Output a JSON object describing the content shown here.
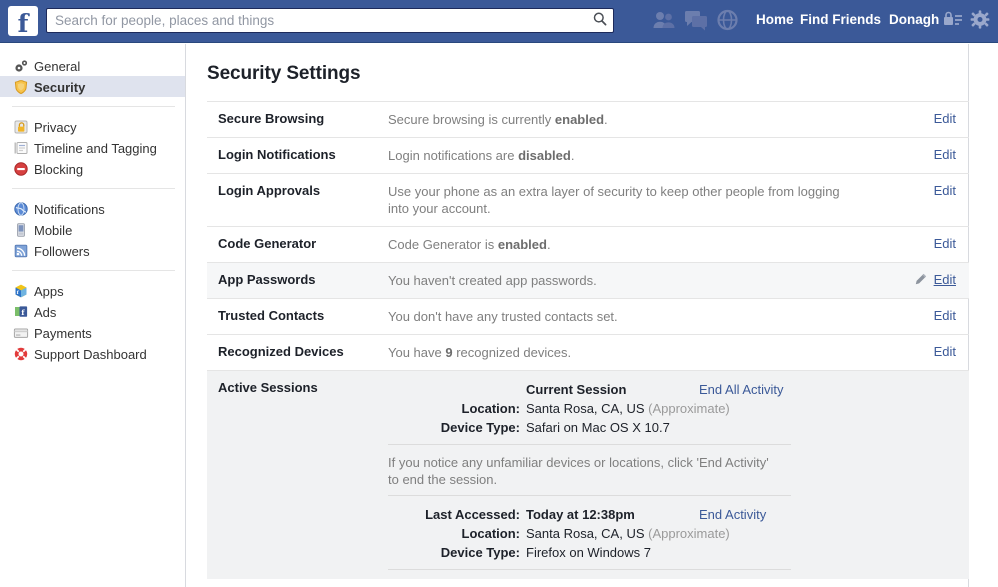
{
  "topbar": {
    "logo_letter": "f",
    "search": {
      "placeholder": "Search for people, places and things",
      "value": ""
    },
    "icons": {
      "friends": "friend-requests-icon",
      "messages": "messages-icon",
      "globe": "notifications-globe-icon",
      "privacy_shortcut": "privacy-shortcuts-icon",
      "settings": "gear-icon"
    },
    "links": {
      "home": "Home",
      "find_friends": "Find Friends",
      "profile": "Donagh"
    }
  },
  "sidebar": {
    "groups": [
      {
        "items": [
          {
            "label": "General",
            "icon": "gears-icon",
            "active": false
          },
          {
            "label": "Security",
            "icon": "shield-icon",
            "active": true
          }
        ]
      },
      {
        "items": [
          {
            "label": "Privacy",
            "icon": "lock-icon",
            "active": false
          },
          {
            "label": "Timeline and Tagging",
            "icon": "timeline-icon",
            "active": false
          },
          {
            "label": "Blocking",
            "icon": "blocking-icon",
            "active": false
          }
        ]
      },
      {
        "items": [
          {
            "label": "Notifications",
            "icon": "globe-icon",
            "active": false
          },
          {
            "label": "Mobile",
            "icon": "mobile-icon",
            "active": false
          },
          {
            "label": "Followers",
            "icon": "followers-icon",
            "active": false
          }
        ]
      },
      {
        "items": [
          {
            "label": "Apps",
            "icon": "apps-icon",
            "active": false
          },
          {
            "label": "Ads",
            "icon": "ads-icon",
            "active": false
          },
          {
            "label": "Payments",
            "icon": "payments-card-icon",
            "active": false
          },
          {
            "label": "Support Dashboard",
            "icon": "support-lifebuoy-icon",
            "active": false
          }
        ]
      }
    ]
  },
  "main": {
    "title": "Security Settings",
    "edit_label": "Edit",
    "rows": [
      {
        "label": "Secure Browsing",
        "desc_pre": "Secure browsing is currently ",
        "desc_bold": "enabled",
        "desc_post": ".",
        "highlight": false
      },
      {
        "label": "Login Notifications",
        "desc_pre": "Login notifications are ",
        "desc_bold": "disabled",
        "desc_post": ".",
        "highlight": false
      },
      {
        "label": "Login Approvals",
        "desc_pre": "Use your phone as an extra layer of security to keep other people from logging into your account.",
        "desc_bold": "",
        "desc_post": "",
        "highlight": false
      },
      {
        "label": "Code Generator",
        "desc_pre": "Code Generator is ",
        "desc_bold": "enabled",
        "desc_post": ".",
        "highlight": false
      },
      {
        "label": "App Passwords",
        "desc_pre": "You haven't created app passwords.",
        "desc_bold": "",
        "desc_post": "",
        "highlight": true
      },
      {
        "label": "Trusted Contacts",
        "desc_pre": "You don't have any trusted contacts set.",
        "desc_bold": "",
        "desc_post": "",
        "highlight": false
      },
      {
        "label": "Recognized Devices",
        "desc_pre": "You have ",
        "desc_bold": "9",
        "desc_post": " recognized devices.",
        "highlight": false
      }
    ],
    "active_sessions": {
      "label": "Active Sessions",
      "current": {
        "heading": "Current Session",
        "end_link": "End All Activity",
        "location_key": "Location:",
        "location_value": "Santa Rosa, CA, US",
        "location_approx": "(Approximate)",
        "device_key": "Device Type:",
        "device_value": "Safari on Mac OS X 10.7"
      },
      "note": "If you notice any unfamiliar devices or locations, click 'End Activity' to end the session.",
      "other": {
        "last_accessed_key": "Last Accessed:",
        "last_accessed_value": "Today at 12:38pm",
        "end_link": "End Activity",
        "location_key": "Location:",
        "location_value": "Santa Rosa, CA, US",
        "location_approx": "(Approximate)",
        "device_key": "Device Type:",
        "device_value": "Firefox on Windows 7"
      }
    }
  },
  "colors": {
    "brand_blue": "#3b5998",
    "link_blue": "#3b5998",
    "active_item_bg": "#dfe3ee",
    "sessions_bg": "#f1f2f3",
    "row_highlight_bg": "#f6f7f8"
  }
}
